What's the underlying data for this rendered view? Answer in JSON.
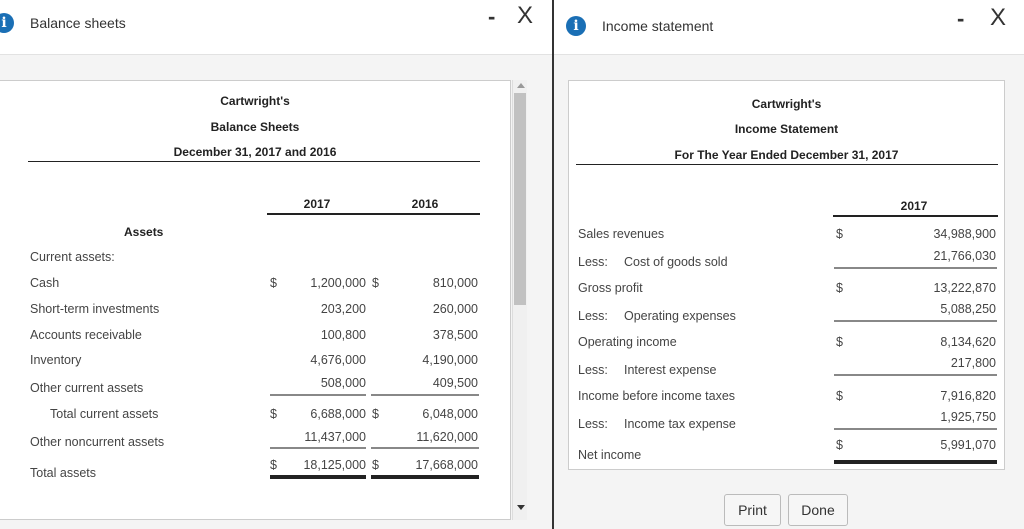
{
  "balance_window": {
    "title": "Balance sheets",
    "company": "Cartwright's",
    "statement": "Balance Sheets",
    "period": "December 31, 2017 and 2016",
    "col_2017": "2017",
    "col_2016": "2016",
    "section": "Assets",
    "current_label": "Current assets:",
    "rows": [
      {
        "label": "Cash",
        "v2017": "1,200,000",
        "v2016": "810,000",
        "dollar": "$"
      },
      {
        "label": "Short-term investments",
        "v2017": "203,200",
        "v2016": "260,000"
      },
      {
        "label": "Accounts receivable",
        "v2017": "100,800",
        "v2016": "378,500"
      },
      {
        "label": "Inventory",
        "v2017": "4,676,000",
        "v2016": "4,190,000"
      },
      {
        "label": "Other current assets",
        "v2017": "508,000",
        "v2016": "409,500"
      },
      {
        "label": "Total current assets",
        "v2017": "6,688,000",
        "v2016": "6,048,000",
        "dollar": "$"
      },
      {
        "label": "Other noncurrent assets",
        "v2017": "11,437,000",
        "v2016": "11,620,000"
      },
      {
        "label": "Total assets",
        "v2017": "18,125,000",
        "v2016": "17,668,000",
        "dollar": "$"
      }
    ],
    "minimize": "-",
    "close": "X"
  },
  "income_window": {
    "title": "Income statement",
    "company": "Cartwright's",
    "statement": "Income Statement",
    "period": "For The Year Ended December 31, 2017",
    "col_2017": "2017",
    "less": "Less:",
    "rows": [
      {
        "label": "Sales revenues",
        "value": "34,988,900",
        "dollar": "$"
      },
      {
        "label": "Cost of goods sold",
        "value": "21,766,030"
      },
      {
        "label": "Gross profit",
        "value": "13,222,870",
        "dollar": "$"
      },
      {
        "label": "Operating expenses",
        "value": "5,088,250"
      },
      {
        "label": "Operating income",
        "value": "8,134,620",
        "dollar": "$"
      },
      {
        "label": "Interest expense",
        "value": "217,800"
      },
      {
        "label": "Income before income taxes",
        "value": "7,916,820",
        "dollar": "$"
      },
      {
        "label": "Income tax expense",
        "value": "1,925,750"
      },
      {
        "label": "Net income",
        "value": "5,991,070",
        "dollar": "$"
      }
    ],
    "print": "Print",
    "done": "Done",
    "minimize": "-",
    "close": "X"
  },
  "colors": {
    "info": "#1a6fb5"
  }
}
